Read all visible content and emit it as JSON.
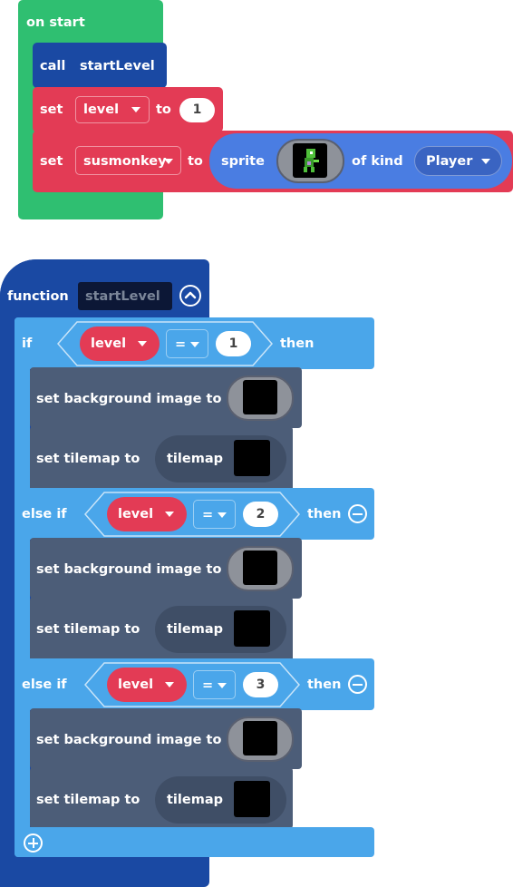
{
  "on_start": {
    "hat_label": "on start",
    "call": {
      "keyword": "call",
      "function": "startLevel"
    },
    "set_level": {
      "keyword": "set",
      "variable": "level",
      "to": "to",
      "value": "1"
    },
    "set_sprite": {
      "keyword": "set",
      "variable": "susmonkey",
      "to": "to",
      "sprite": "sprite",
      "of_kind": "of kind",
      "kind": "Player"
    }
  },
  "function": {
    "keyword": "function",
    "name": "startLevel",
    "branches": [
      {
        "keyword": "if",
        "variable": "level",
        "op": "=",
        "value": "1",
        "then": "then",
        "bg_label": "set background image to",
        "tm_label": "set tilemap to",
        "tilemap": "tilemap"
      },
      {
        "keyword": "else if",
        "variable": "level",
        "op": "=",
        "value": "2",
        "then": "then",
        "bg_label": "set background image to",
        "tm_label": "set tilemap to",
        "tilemap": "tilemap"
      },
      {
        "keyword": "else if",
        "variable": "level",
        "op": "=",
        "value": "3",
        "then": "then",
        "bg_label": "set background image to",
        "tm_label": "set tilemap to",
        "tilemap": "tilemap"
      }
    ]
  },
  "colors": {
    "events": "#2fbf71",
    "functions": "#1a49a3",
    "variables": "#e33b55",
    "logic": "#4aa6ea",
    "scene": "#4c5d78",
    "sprites": "#4a7de2"
  }
}
